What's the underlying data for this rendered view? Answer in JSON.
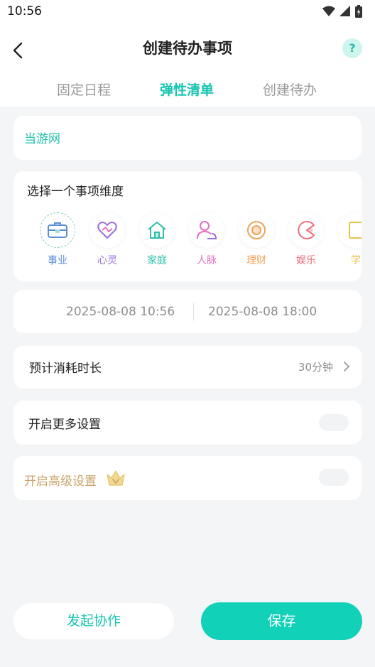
{
  "status_bar": {
    "time": "10:56"
  },
  "header": {
    "title": "创建待办事项",
    "help": "?"
  },
  "tabs": [
    {
      "label": "固定日程",
      "active": false
    },
    {
      "label": "弹性清单",
      "active": true
    },
    {
      "label": "创建待办",
      "active": false
    }
  ],
  "todo_name": {
    "value": "当游网"
  },
  "dimension": {
    "title": "选择一个事项维度",
    "selected": "事业",
    "categories": [
      {
        "label": "事业",
        "icon": "briefcase-icon",
        "color": "#5b8fd8"
      },
      {
        "label": "心灵",
        "icon": "heart-icon",
        "color": "#9b6fdc"
      },
      {
        "label": "家庭",
        "icon": "home-icon",
        "color": "#2dbfa8"
      },
      {
        "label": "人脉",
        "icon": "people-icon",
        "color": "#e46ec3"
      },
      {
        "label": "理财",
        "icon": "coin-icon",
        "color": "#eea35a"
      },
      {
        "label": "娱乐",
        "icon": "pacman-icon",
        "color": "#ee6e7a"
      },
      {
        "label": "学",
        "icon": "book-icon",
        "color": "#e8c24a"
      }
    ]
  },
  "time_range": {
    "start": "2025-08-08 10:56",
    "end": "2025-08-08 18:00"
  },
  "duration": {
    "label": "预计消耗时长",
    "value": "30分钟"
  },
  "more_settings": {
    "label": "开启更多设置",
    "enabled": false
  },
  "advanced_settings": {
    "label": "开启高级设置",
    "enabled": false
  },
  "actions": {
    "collaborate": "发起协作",
    "save": "保存"
  },
  "colors": {
    "accent": "#17c5b0",
    "background": "#f4f5f7",
    "gold": "#c9a36b"
  }
}
